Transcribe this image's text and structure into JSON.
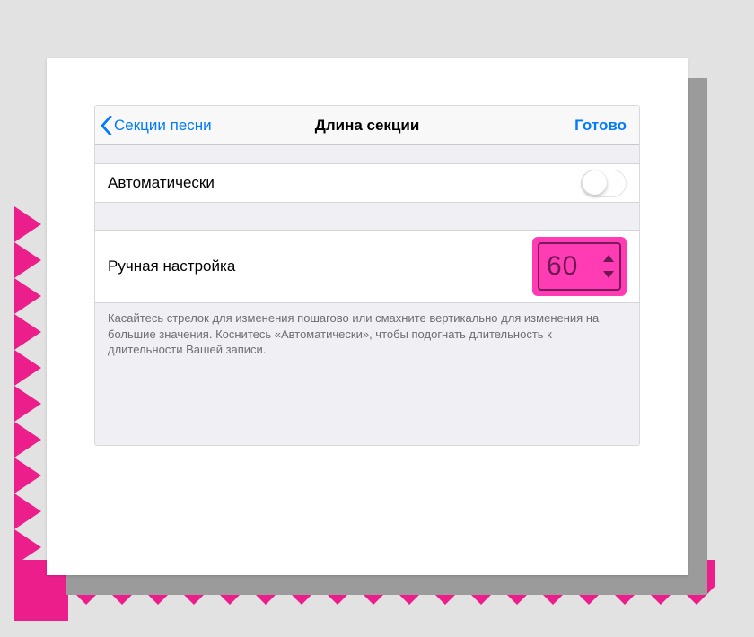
{
  "nav": {
    "back": "Секции песни",
    "title": "Длина секции",
    "done": "Готово"
  },
  "rows": {
    "auto_label": "Автоматически",
    "manual_label": "Ручная настройка",
    "manual_value": "60"
  },
  "footer": "Касайтесь стрелок для изменения пошагово или смахните вертикально для изменения на большие значения. Коснитесь «Автоматически», чтобы подогнать длительность к длительности Вашей записи.",
  "colors": {
    "accent": "#007aff",
    "highlight": "#ff3cb4",
    "zigzag": "#ec1e8c"
  }
}
